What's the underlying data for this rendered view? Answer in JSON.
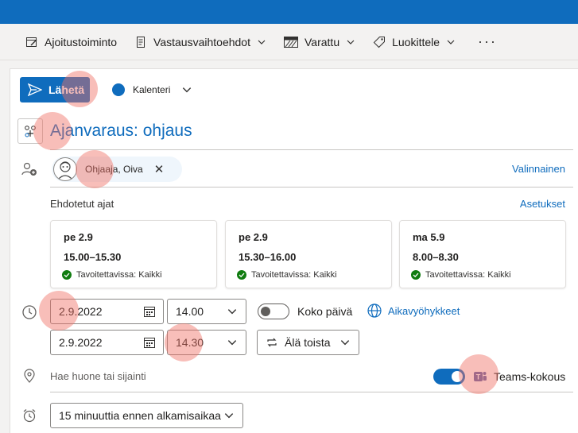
{
  "ribbon": {
    "items": [
      {
        "label": "Ajoitustoiminto",
        "icon": "scheduling-icon",
        "has_dropdown": false
      },
      {
        "label": "Vastausvaihtoehdot",
        "icon": "response-options-icon",
        "has_dropdown": true
      },
      {
        "label": "Varattu",
        "icon": "busy-status-icon",
        "has_dropdown": true
      },
      {
        "label": "Luokittele",
        "icon": "tag-icon",
        "has_dropdown": true
      }
    ],
    "more": "···"
  },
  "compose": {
    "send_label": "Lähetä",
    "calendar_label": "Kalenteri",
    "calendar_color": "#0f6cbd",
    "title": "Ajanvaraus: ohjaus"
  },
  "attendees": {
    "chip_name": "Ohjaaja, Oiva",
    "optional_link": "Valinnainen"
  },
  "suggested": {
    "heading": "Ehdotetut ajat",
    "settings_link": "Asetukset",
    "slots": [
      {
        "day": "pe 2.9",
        "time": "15.00–15.30",
        "availability": "Tavoitettavissa: Kaikki"
      },
      {
        "day": "pe 2.9",
        "time": "15.30–16.00",
        "availability": "Tavoitettavissa: Kaikki"
      },
      {
        "day": "ma 5.9",
        "time": "8.00–8.30",
        "availability": "Tavoitettavissa: Kaikki"
      }
    ]
  },
  "datetime": {
    "start_date": "2.9.2022",
    "start_time": "14.00",
    "end_date": "2.9.2022",
    "end_time": "14.30",
    "all_day_label": "Koko päivä",
    "all_day_on": false,
    "timezone_link": "Aikavyöhykkeet",
    "repeat_label": "Älä toista"
  },
  "location": {
    "placeholder": "Hae huone tai sijainti",
    "teams_label": "Teams-kokous",
    "teams_on": true
  },
  "reminder": {
    "value": "15 minuuttia ennen alkamisaikaa"
  },
  "colors": {
    "accent": "#0f6cbd",
    "highlight": "#f06e64",
    "available_green": "#107c10",
    "teams_purple": "#6264a7"
  }
}
